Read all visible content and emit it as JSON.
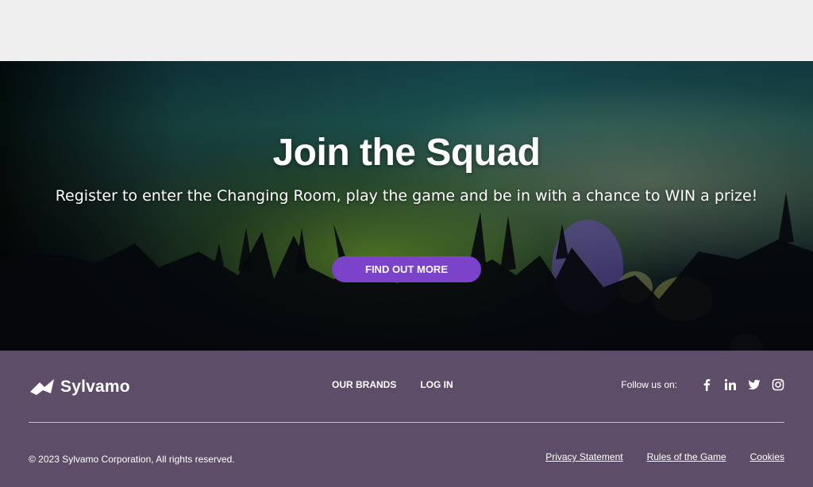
{
  "hero": {
    "title": "Join the Squad",
    "subtitle": "Register to enter the Changing Room, play the game and be in with a chance to WIN a prize!",
    "cta_label": "FIND OUT MORE"
  },
  "footer": {
    "logo_text": "Sylvamo",
    "nav": [
      {
        "label": "OUR BRANDS"
      },
      {
        "label": "LOG IN"
      }
    ],
    "follow_label": "Follow us on:",
    "social_icons": [
      "facebook-icon",
      "linkedin-icon",
      "twitter-icon",
      "instagram-icon"
    ],
    "copyright": "© 2023 Sylvamo Corporation, All rights reserved.",
    "legal_links": [
      {
        "label": "Privacy Statement"
      },
      {
        "label": "Rules of the Game"
      },
      {
        "label": "Cookies"
      }
    ]
  },
  "colors": {
    "cta": "#7a43c9",
    "footer_bg": "#5d4d69",
    "top_bar": "#efefef"
  }
}
